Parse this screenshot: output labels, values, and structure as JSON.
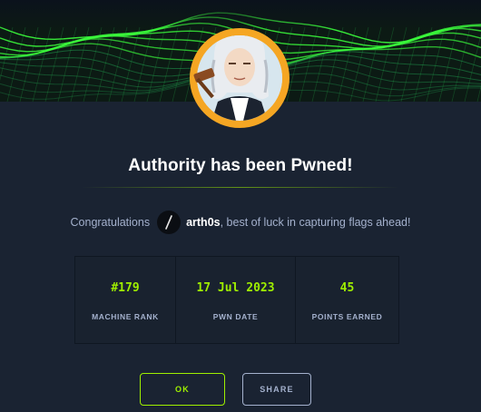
{
  "dialog": {
    "title": "Authority has been Pwned!",
    "congrats_prefix": "Congratulations",
    "username": "arth0s",
    "congrats_suffix": ", best of luck in capturing flags ahead!"
  },
  "stats": [
    {
      "value": "#179",
      "label": "MACHINE RANK"
    },
    {
      "value": "17 Jul 2023",
      "label": "PWN DATE"
    },
    {
      "value": "45",
      "label": "POINTS EARNED"
    }
  ],
  "buttons": {
    "ok_label": "OK",
    "share_label": "SHARE"
  },
  "colors": {
    "accent": "#9fef00",
    "background": "#1a2332",
    "muted": "#a4b1cd",
    "avatar_ring": "#f5a623"
  }
}
